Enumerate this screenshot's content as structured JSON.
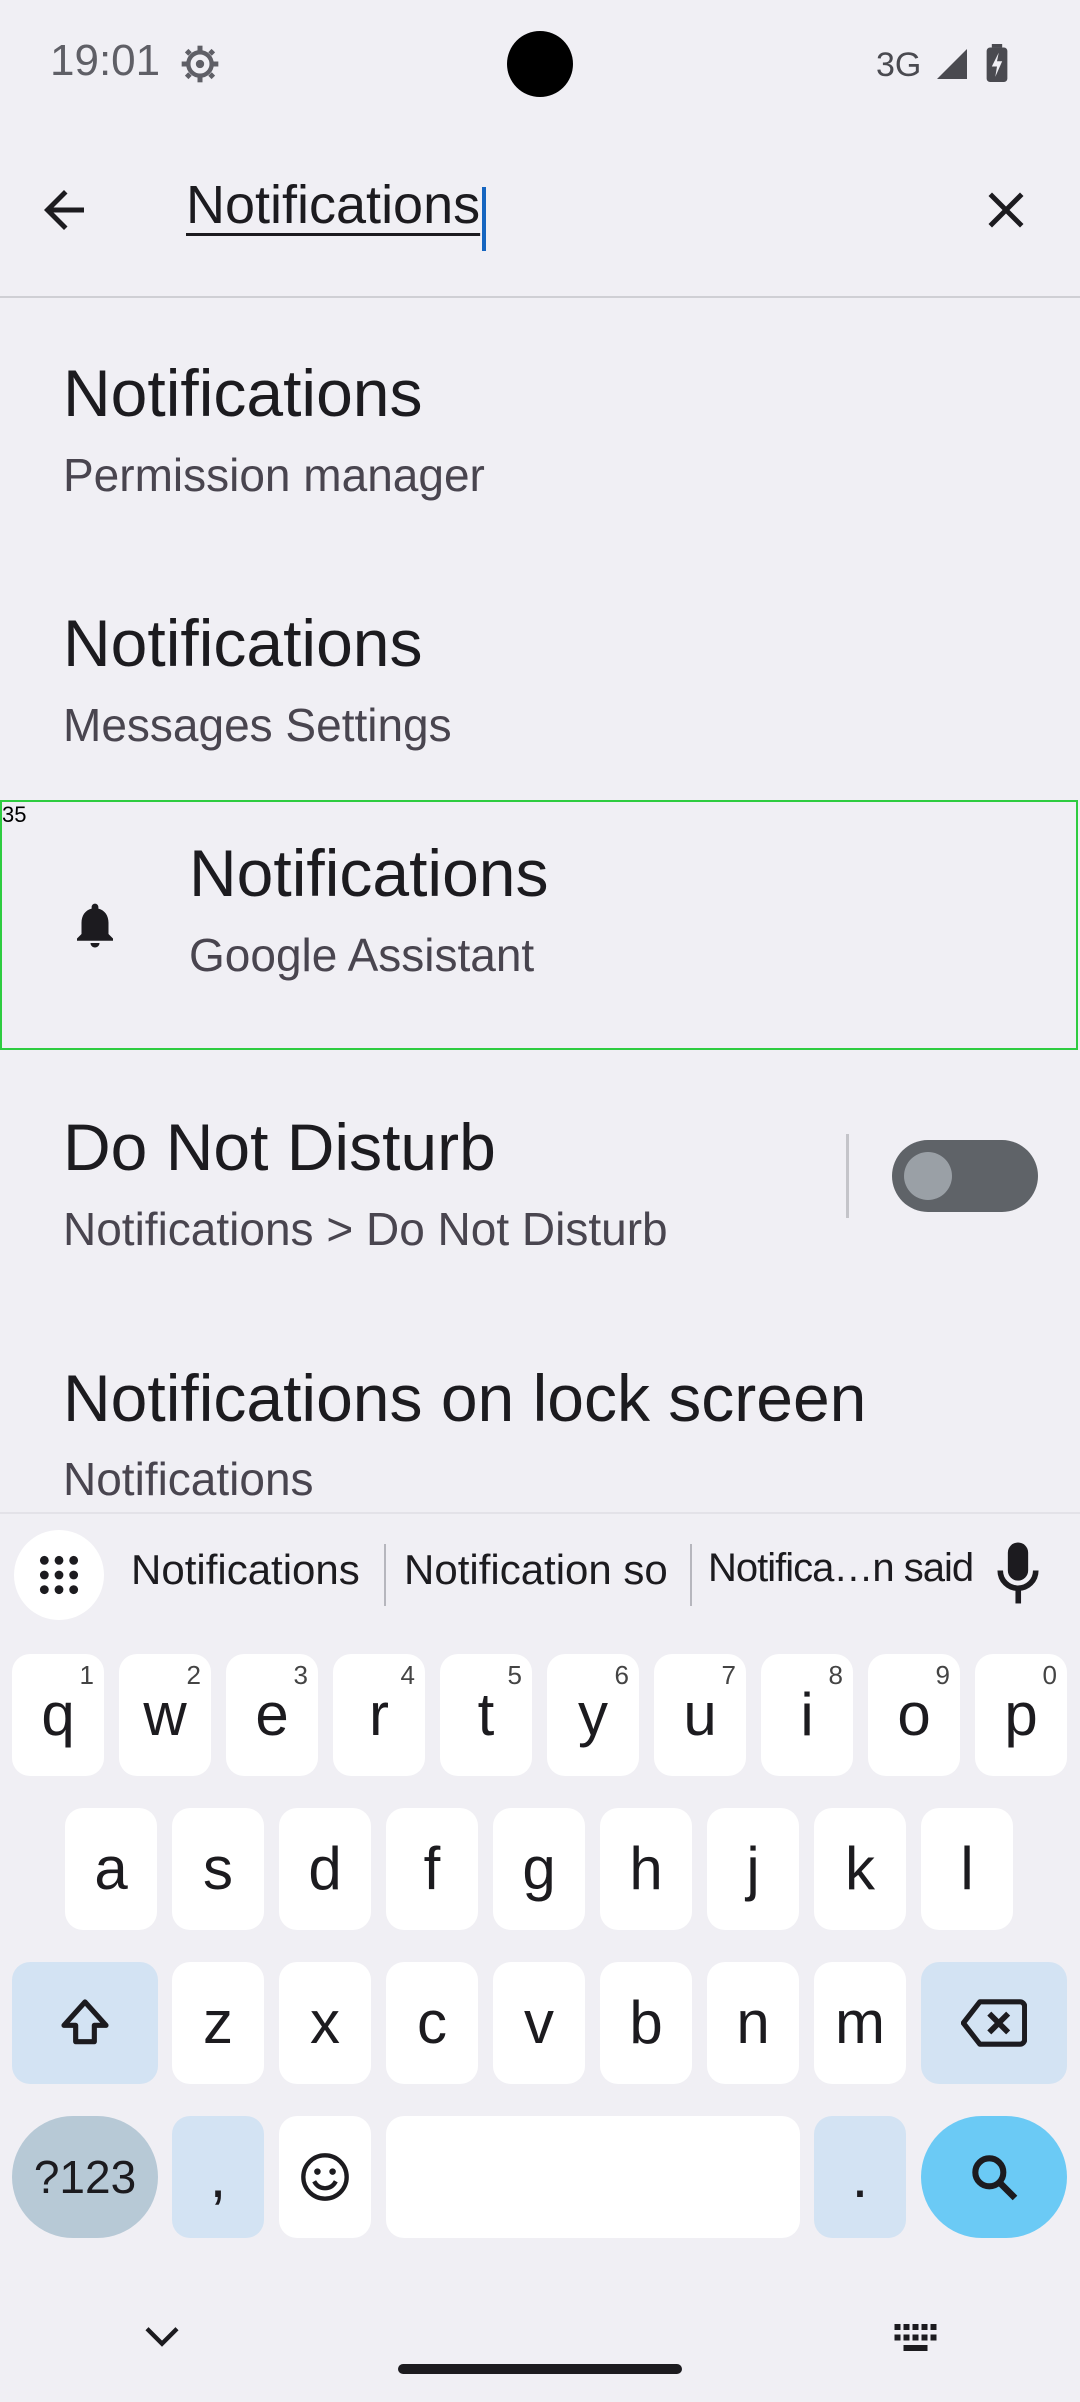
{
  "status_bar": {
    "time": "19:01",
    "network": "3G",
    "icons": [
      "gear-icon",
      "signal-icon",
      "battery-charging-icon"
    ]
  },
  "search": {
    "query": "Notifications",
    "back_icon": "arrow-left-icon",
    "clear_icon": "close-icon"
  },
  "results": [
    {
      "title": "Notifications",
      "subtitle": "Permission manager"
    },
    {
      "title": "Notifications",
      "subtitle": "Messages Settings"
    },
    {
      "title": "Notifications",
      "subtitle": "Google Assistant",
      "icon": "bell-icon",
      "marker": "35"
    },
    {
      "title": "Do Not Disturb",
      "subtitle": "Notifications > Do Not Disturb",
      "toggle": "off"
    },
    {
      "title": "Notifications on lock screen",
      "subtitle": "Notifications"
    }
  ],
  "keyboard": {
    "suggestions": [
      "Notifications",
      "Notification so",
      "Notifica…n said"
    ],
    "row1": [
      {
        "key": "q",
        "hint": "1"
      },
      {
        "key": "w",
        "hint": "2"
      },
      {
        "key": "e",
        "hint": "3"
      },
      {
        "key": "r",
        "hint": "4"
      },
      {
        "key": "t",
        "hint": "5"
      },
      {
        "key": "y",
        "hint": "6"
      },
      {
        "key": "u",
        "hint": "7"
      },
      {
        "key": "i",
        "hint": "8"
      },
      {
        "key": "o",
        "hint": "9"
      },
      {
        "key": "p",
        "hint": "0"
      }
    ],
    "row2": [
      "a",
      "s",
      "d",
      "f",
      "g",
      "h",
      "j",
      "k",
      "l"
    ],
    "row3": [
      "z",
      "x",
      "c",
      "v",
      "b",
      "n",
      "m"
    ],
    "num_key": "?123",
    "comma_key": ",",
    "period_key": ".",
    "accent_colors": {
      "search_key": "#6bcaf5",
      "special_key": "#d3e3f3"
    }
  }
}
